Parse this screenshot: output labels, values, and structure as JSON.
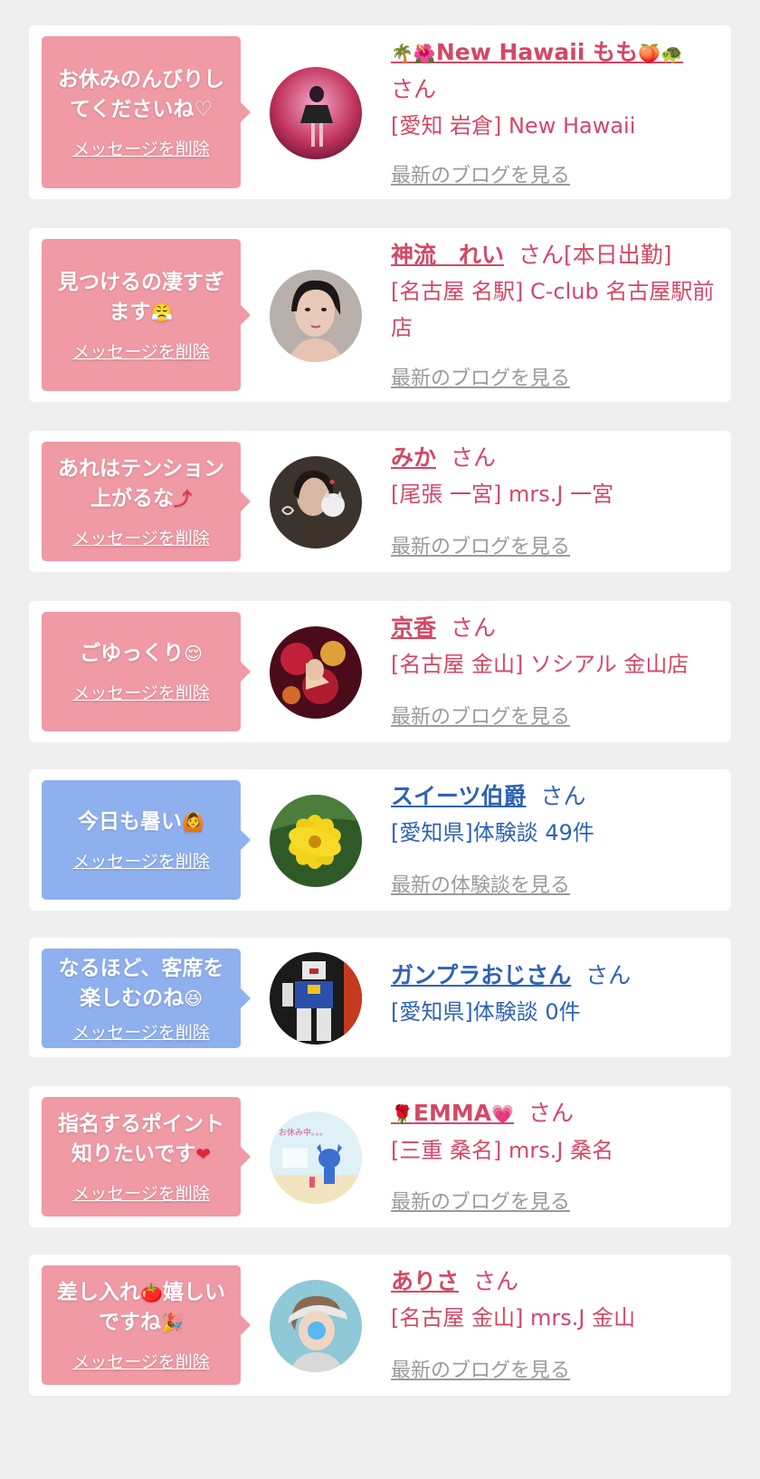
{
  "delete_label": "メッセージを削除",
  "colors": {
    "pink_bubble": "#ef9aa4",
    "blue_bubble": "#8fb0ef",
    "pink_text": "#d44865",
    "blue_text": "#2e63b4",
    "link_gray": "#9a9a9a",
    "card_bg": "#ffffff",
    "page_bg": "#efefef"
  },
  "cards": [
    {
      "message_lines": [
        "お休みのんびりし",
        "てくださいね♡"
      ],
      "name_prefix_emoji": "🌴🌺",
      "name": "New Hawaii もも",
      "name_suffix_emoji": "🍑🐢",
      "honorific": "さん",
      "location": "[愛知 岩倉] New Hawaii",
      "link": "最新のブログを見る"
    },
    {
      "message_lines": [
        "見つけるの凄すぎ",
        "ます"
      ],
      "message_emoji": "😤",
      "name": "神流　れい",
      "honorific": "さん[本日出勤]",
      "location": "[名古屋 名駅] C-club 名古屋駅前店",
      "link": "最新のブログを見る"
    },
    {
      "message_lines": [
        "あれはテンション",
        "上がるな"
      ],
      "message_emoji": "⤴",
      "name": "みか",
      "honorific": "さん",
      "location": "[尾張 一宮] mrs.J 一宮",
      "link": "最新のブログを見る"
    },
    {
      "message_lines": [
        "ごゆっくり"
      ],
      "message_emoji": "😌",
      "name": "京香",
      "honorific": "さん",
      "location": "[名古屋 金山] ソシアル 金山店",
      "link": "最新のブログを見る"
    },
    {
      "message_lines": [
        "今日も暑い"
      ],
      "message_emoji": "🙆",
      "name": "スイーツ伯爵",
      "honorific": "さん",
      "location": "[愛知県]体験談 49件",
      "link": "最新の体験談を見る"
    },
    {
      "message_lines": [
        "なるほど、客席を",
        "楽しむのね"
      ],
      "message_emoji": "😆",
      "name": "ガンプラおじさん",
      "honorific": "さん",
      "location": "[愛知県]体験談 0件"
    },
    {
      "message_lines": [
        "指名するポイント",
        "知りたいです"
      ],
      "message_emoji": "❤",
      "name_prefix_emoji": "🌹",
      "name": "EMMA",
      "name_suffix_emoji": "💗",
      "honorific": "さん",
      "location": "[三重 桑名] mrs.J 桑名",
      "link": "最新のブログを見る",
      "avatar_text": "お休み中。。。"
    },
    {
      "message_lines": [
        "差し入れ",
        "ですね"
      ],
      "message_emoji_inline": "🍅",
      "message_line1_tail": "嬉しい",
      "message_emoji": "🎉",
      "name": "ありさ",
      "honorific": "さん",
      "location": "[名古屋 金山] mrs.J 金山",
      "link": "最新のブログを見る"
    }
  ]
}
